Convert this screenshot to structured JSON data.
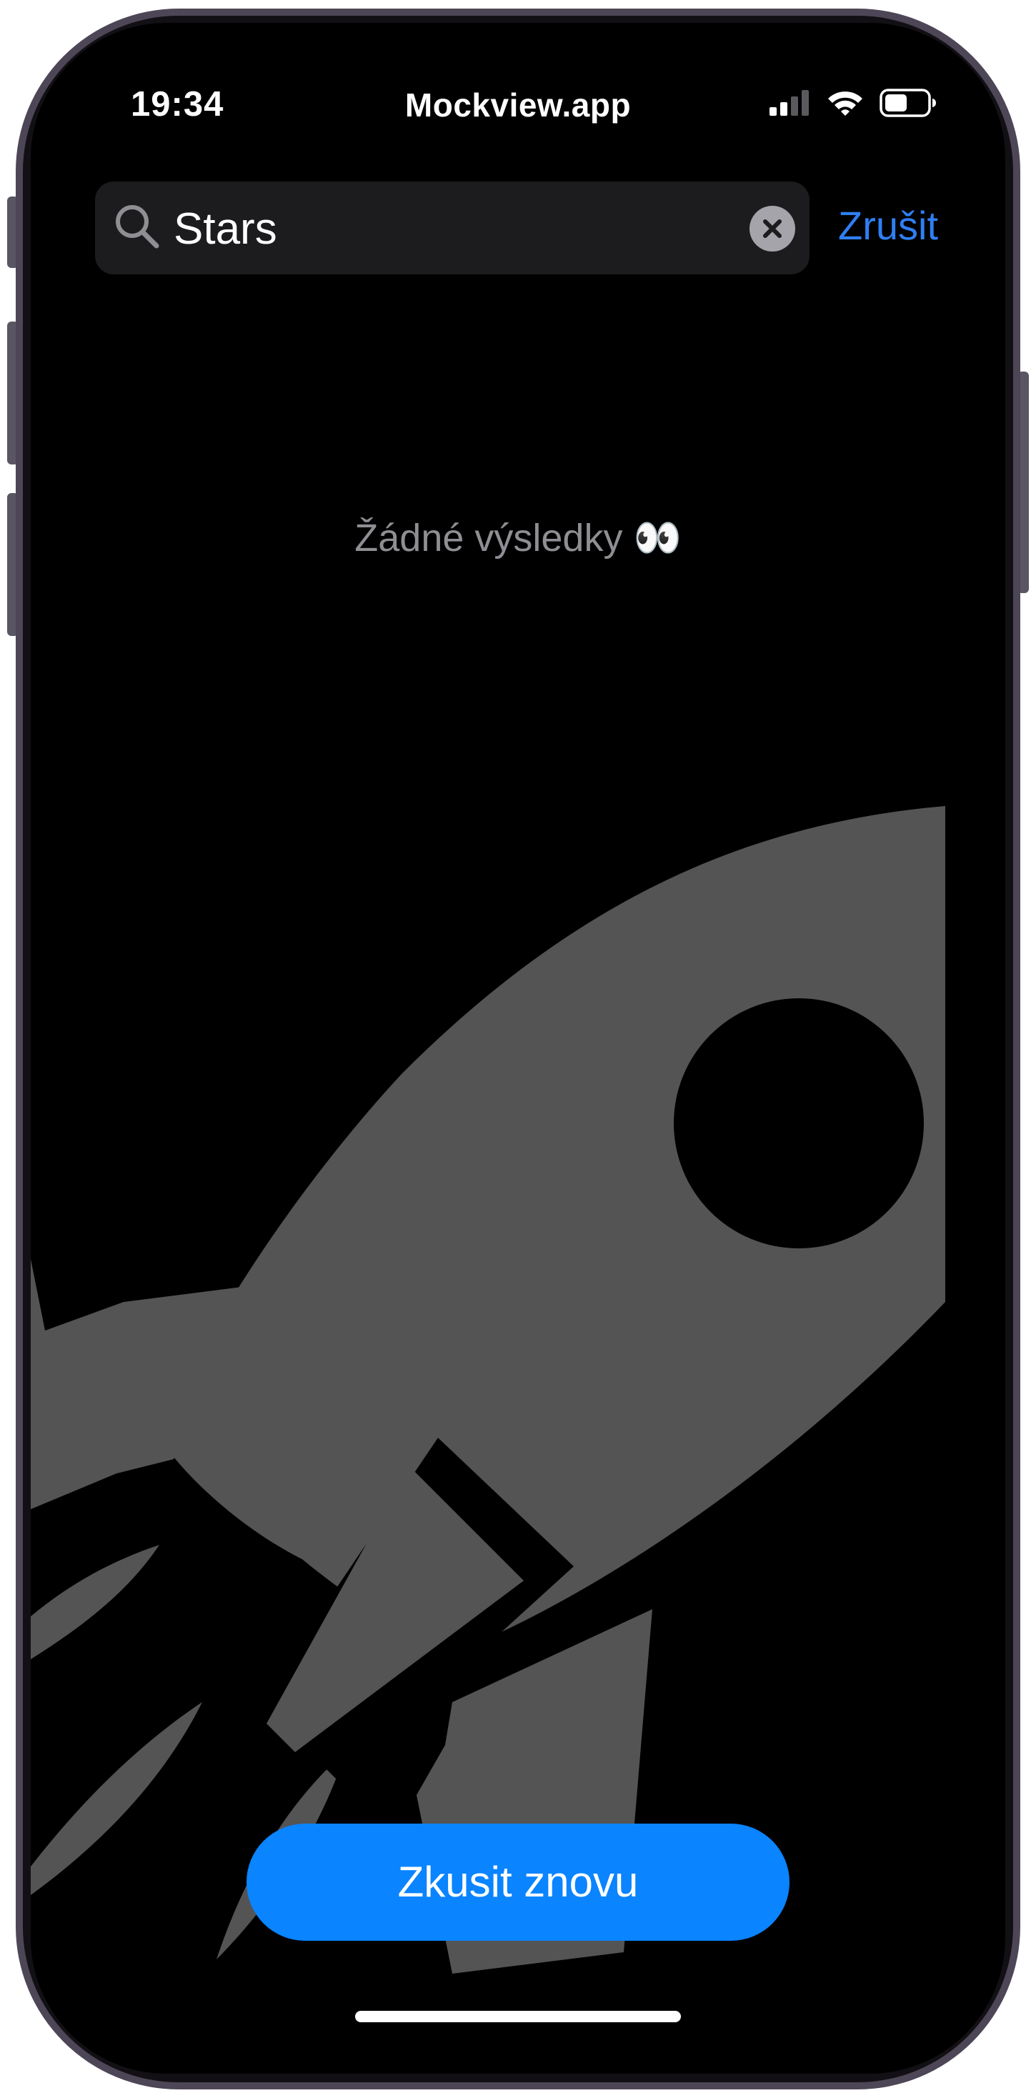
{
  "status_bar": {
    "time": "19:34",
    "url": "Mockview.app",
    "icons": [
      "cellular-signal-icon",
      "wifi-icon",
      "battery-icon"
    ]
  },
  "search": {
    "query": "Stars",
    "placeholder": "",
    "cancel_label": "Zrušit"
  },
  "results": {
    "empty_message": "Žádné výsledky 👀"
  },
  "actions": {
    "retry_label": "Zkusit znovu"
  },
  "colors": {
    "accent": "#0a84ff",
    "link": "#2f7ff3",
    "background": "#000000",
    "illustration": "#545454",
    "muted_text": "#8e8e93"
  }
}
